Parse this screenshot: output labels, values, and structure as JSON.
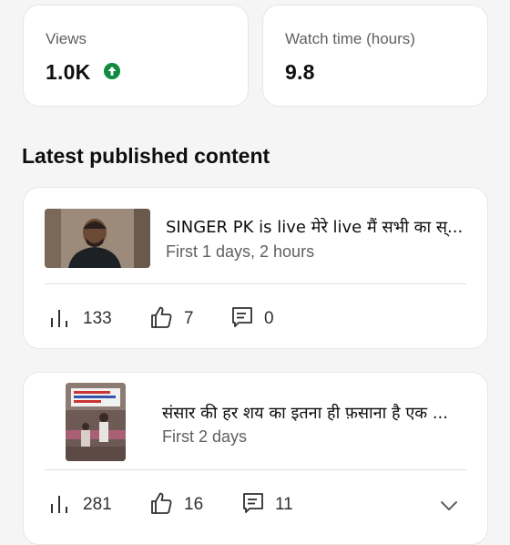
{
  "stats": [
    {
      "label": "Views",
      "value": "1.0K",
      "trend": "up",
      "trend_color": "#108a3e"
    },
    {
      "label": "Watch time (hours)",
      "value": "9.8"
    }
  ],
  "section_title": "Latest published content",
  "videos": [
    {
      "title": "SINGER PK is live मेरे live मैं सभी का स्...",
      "subtitle": "First 1 days, 2 hours",
      "views": "133",
      "likes": "7",
      "comments": "0"
    },
    {
      "title": "संसार की हर शय का इतना ही फ़साना है एक ...",
      "subtitle": "First 2 days",
      "views": "281",
      "likes": "16",
      "comments": "11"
    }
  ],
  "colors": {
    "background": "#f5f5f5",
    "card": "#ffffff",
    "text_primary": "#0f0f0f",
    "text_secondary": "#606060",
    "trend_up": "#108a3e"
  },
  "icons": [
    "arrow-up-circle-icon",
    "bar-chart-icon",
    "thumbs-up-icon",
    "comment-icon",
    "chevron-down-icon"
  ]
}
